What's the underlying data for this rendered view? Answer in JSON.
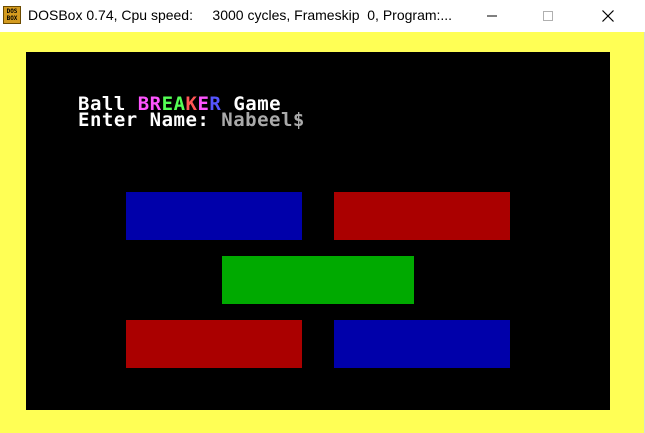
{
  "window": {
    "icon_text_top": "DOS",
    "icon_text_bottom": "BOX",
    "title": "DOSBox 0.74, Cpu speed:     3000 cycles, Frameskip  0, Program:..."
  },
  "controls": {
    "minimize_icon": "minimize-icon",
    "maximize_icon": "maximize-icon",
    "close_icon": "close-icon"
  },
  "colors": {
    "border": "#ffff55",
    "screen": "#000000",
    "blue": "#0000aa",
    "red": "#aa0000",
    "green": "#00aa00"
  },
  "game": {
    "title_prefix": "Ball ",
    "breaker_letters": [
      {
        "ch": "B",
        "color": "#ff55ff"
      },
      {
        "ch": "R",
        "color": "#ff55ff"
      },
      {
        "ch": "E",
        "color": "#55ff55"
      },
      {
        "ch": "A",
        "color": "#55ff55"
      },
      {
        "ch": "K",
        "color": "#ff5555"
      },
      {
        "ch": "E",
        "color": "#ff55ff"
      },
      {
        "ch": "R",
        "color": "#5555ff"
      }
    ],
    "title_suffix": " Game",
    "name_label": "Enter Name: ",
    "name_value": "Nabeel$"
  },
  "bricks": [
    {
      "name": "brick-blue-top-left",
      "color": "#0000aa"
    },
    {
      "name": "brick-red-top-right",
      "color": "#aa0000"
    },
    {
      "name": "brick-green-middle",
      "color": "#00aa00"
    },
    {
      "name": "brick-red-bottom-left",
      "color": "#aa0000"
    },
    {
      "name": "brick-blue-bottom-right",
      "color": "#0000aa"
    }
  ]
}
